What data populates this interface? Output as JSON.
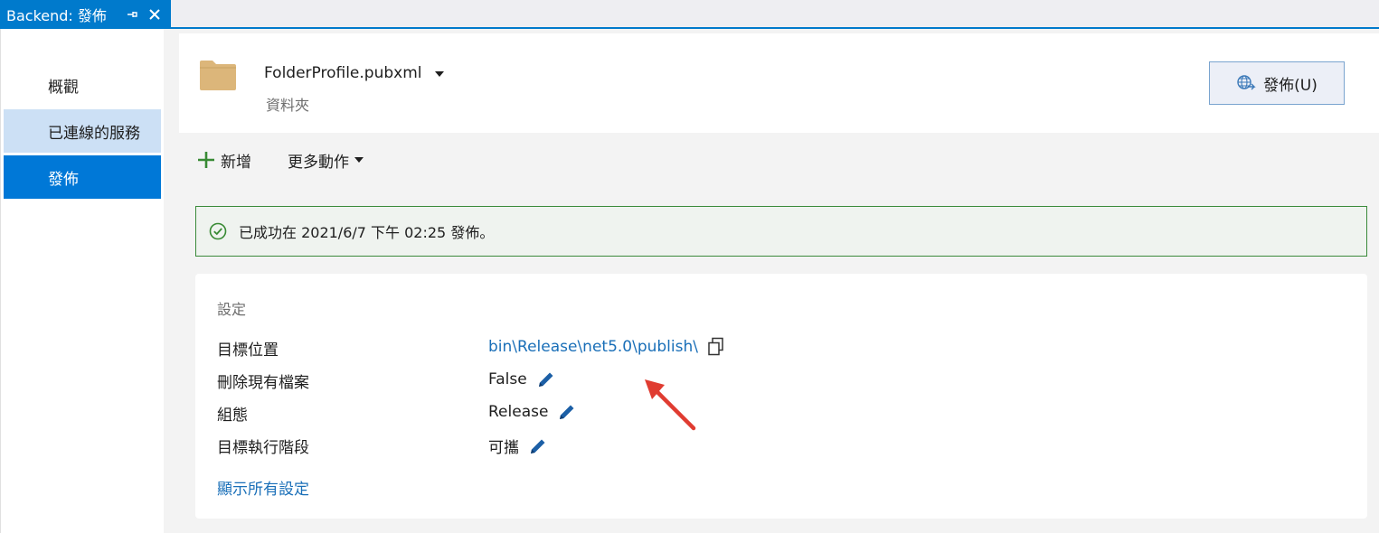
{
  "tab": {
    "title": "Backend: 發佈"
  },
  "nav": {
    "items": [
      {
        "label": "概觀"
      },
      {
        "label": "已連線的服務"
      },
      {
        "label": "發佈"
      }
    ]
  },
  "profile": {
    "name": "FolderProfile.pubxml",
    "type": "資料夾",
    "publish_button": "發佈(U)"
  },
  "toolbar": {
    "add_label": "新增",
    "more_label": "更多動作"
  },
  "status": {
    "message": "已成功在 2021/6/7 下午 02:25 發佈。",
    "color": "#3a8a3a"
  },
  "settings": {
    "title": "設定",
    "rows": [
      {
        "label": "目標位置",
        "value": "bin\\Release\\net5.0\\publish\\"
      },
      {
        "label": "刪除現有檔案",
        "value": "False"
      },
      {
        "label": "組態",
        "value": "Release"
      },
      {
        "label": "目標執行階段",
        "value": "可攜"
      }
    ],
    "show_all": "顯示所有設定"
  },
  "colors": {
    "accent": "#007acc",
    "nav_selected": "#0078d7",
    "nav_hover": "#cce0f5",
    "link": "#1a6fb8",
    "annotation_arrow": "#e03c31"
  }
}
